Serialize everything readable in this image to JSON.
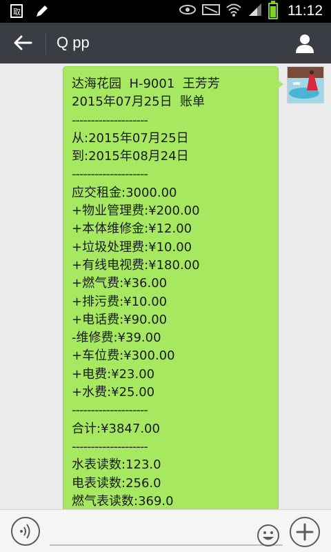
{
  "status_bar": {
    "time": "11:12",
    "icons": [
      "sim-icon",
      "edit-icon",
      "eye-icon",
      "nfc-icon",
      "wifi-icon",
      "signal-icon",
      "battery-icon"
    ],
    "battery_color": "#7fd22a"
  },
  "header": {
    "title": "Q pp",
    "back_icon": "back-arrow-icon",
    "profile_icon": "person-icon",
    "background": "#3a3d44"
  },
  "message": {
    "bubble_color": "#a6e860",
    "lines": [
      "达海花园  H-9001  王芳芳",
      "2015年07月25日  账单",
      "--------------------",
      "从:2015年07月25日",
      "到:2015年08月24日",
      "--------------------",
      "应交租金:3000.00",
      "+物业管理费:¥200.00",
      "+本体维修金:¥12.00",
      "+垃圾处理费:¥10.00",
      "+有线电视费:¥180.00",
      "+燃气费:¥36.00",
      "+排污费:¥10.00",
      "+电话费:¥90.00",
      "-维修费:¥39.00",
      "+车位费:¥300.00",
      "+电费:¥23.00",
      "+水费:¥25.00",
      "--------------------",
      "合计:¥3847.00",
      "--------------------",
      "水表读数:123.0",
      "电表读数:256.0",
      "燃气表读数:369.0"
    ]
  },
  "input_bar": {
    "voice_icon": "voice-icon",
    "emoji_icon": "emoji-icon",
    "plus_icon": "plus-icon"
  }
}
